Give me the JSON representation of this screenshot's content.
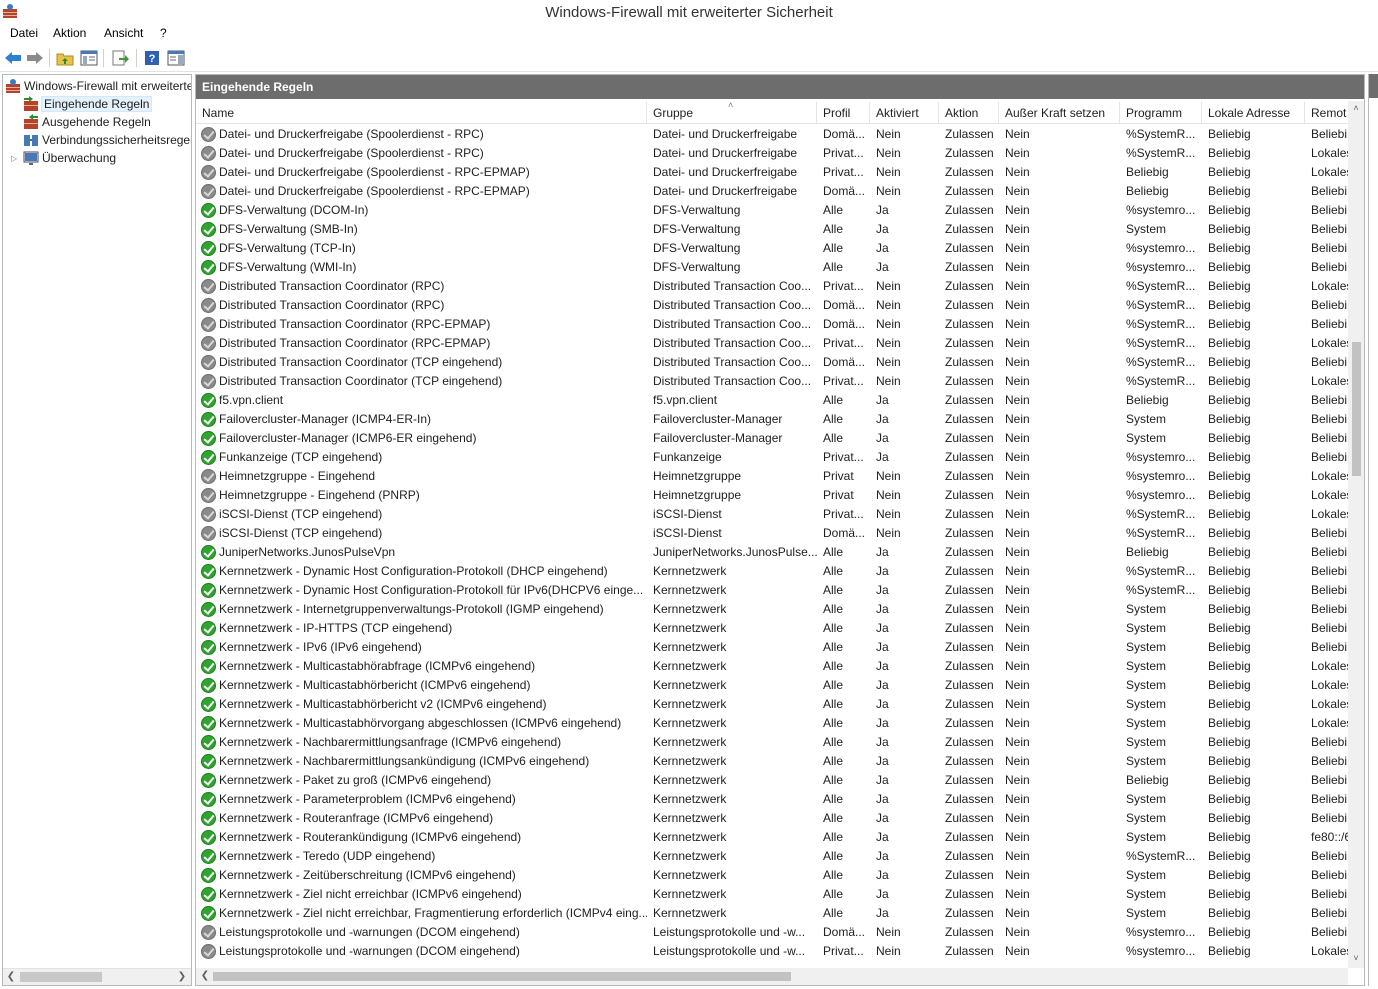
{
  "window": {
    "title": "Windows-Firewall mit erweiterter Sicherheit"
  },
  "menu": [
    "Datei",
    "Aktion",
    "Ansicht",
    "?"
  ],
  "toolbar": {
    "buttons": [
      "back-icon",
      "forward-icon",
      "up-folder-icon",
      "show-hide-tree-icon",
      "export-icon",
      "help-icon",
      "show-hide-action-pane-icon"
    ]
  },
  "tree": {
    "root": "Windows-Firewall mit erweiterter Sicherheit",
    "items": [
      {
        "label": "Eingehende Regeln",
        "selected": true
      },
      {
        "label": "Ausgehende Regeln",
        "selected": false
      },
      {
        "label": "Verbindungssicherheitsregeln",
        "selected": false
      },
      {
        "label": "Überwachung",
        "selected": false
      }
    ]
  },
  "pane": {
    "title": "Eingehende Regeln"
  },
  "columns": [
    "Name",
    "Gruppe",
    "Profil",
    "Aktiviert",
    "Aktion",
    "Außer Kraft setzen",
    "Programm",
    "Lokale Adresse",
    "Remot"
  ],
  "colors": {
    "enabled": "#2fa52f",
    "disabled": "#8a8a8a",
    "header": "#6d6d6d"
  },
  "rows": [
    [
      "d",
      "Datei- und Druckerfreigabe (Spoolerdienst - RPC)",
      "Datei- und Druckerfreigabe",
      "Domä...",
      "Nein",
      "Zulassen",
      "Nein",
      "%SystemR...",
      "Beliebig",
      "Beliebi"
    ],
    [
      "d",
      "Datei- und Druckerfreigabe (Spoolerdienst - RPC)",
      "Datei- und Druckerfreigabe",
      "Privat...",
      "Nein",
      "Zulassen",
      "Nein",
      "%SystemR...",
      "Beliebig",
      "Lokales"
    ],
    [
      "d",
      "Datei- und Druckerfreigabe (Spoolerdienst - RPC-EPMAP)",
      "Datei- und Druckerfreigabe",
      "Privat...",
      "Nein",
      "Zulassen",
      "Nein",
      "Beliebig",
      "Beliebig",
      "Lokales"
    ],
    [
      "d",
      "Datei- und Druckerfreigabe (Spoolerdienst - RPC-EPMAP)",
      "Datei- und Druckerfreigabe",
      "Domä...",
      "Nein",
      "Zulassen",
      "Nein",
      "Beliebig",
      "Beliebig",
      "Beliebi"
    ],
    [
      "e",
      "DFS-Verwaltung (DCOM-In)",
      "DFS-Verwaltung",
      "Alle",
      "Ja",
      "Zulassen",
      "Nein",
      "%systemro...",
      "Beliebig",
      "Beliebi"
    ],
    [
      "e",
      "DFS-Verwaltung (SMB-In)",
      "DFS-Verwaltung",
      "Alle",
      "Ja",
      "Zulassen",
      "Nein",
      "System",
      "Beliebig",
      "Beliebi"
    ],
    [
      "e",
      "DFS-Verwaltung (TCP-In)",
      "DFS-Verwaltung",
      "Alle",
      "Ja",
      "Zulassen",
      "Nein",
      "%systemro...",
      "Beliebig",
      "Beliebi"
    ],
    [
      "e",
      "DFS-Verwaltung (WMI-In)",
      "DFS-Verwaltung",
      "Alle",
      "Ja",
      "Zulassen",
      "Nein",
      "%systemro...",
      "Beliebig",
      "Beliebi"
    ],
    [
      "d",
      "Distributed Transaction Coordinator (RPC)",
      "Distributed Transaction Coo...",
      "Privat...",
      "Nein",
      "Zulassen",
      "Nein",
      "%SystemR...",
      "Beliebig",
      "Lokales"
    ],
    [
      "d",
      "Distributed Transaction Coordinator (RPC)",
      "Distributed Transaction Coo...",
      "Domä...",
      "Nein",
      "Zulassen",
      "Nein",
      "%SystemR...",
      "Beliebig",
      "Beliebi"
    ],
    [
      "d",
      "Distributed Transaction Coordinator (RPC-EPMAP)",
      "Distributed Transaction Coo...",
      "Domä...",
      "Nein",
      "Zulassen",
      "Nein",
      "%SystemR...",
      "Beliebig",
      "Beliebi"
    ],
    [
      "d",
      "Distributed Transaction Coordinator (RPC-EPMAP)",
      "Distributed Transaction Coo...",
      "Privat...",
      "Nein",
      "Zulassen",
      "Nein",
      "%SystemR...",
      "Beliebig",
      "Lokales"
    ],
    [
      "d",
      "Distributed Transaction Coordinator (TCP eingehend)",
      "Distributed Transaction Coo...",
      "Domä...",
      "Nein",
      "Zulassen",
      "Nein",
      "%SystemR...",
      "Beliebig",
      "Beliebi"
    ],
    [
      "d",
      "Distributed Transaction Coordinator (TCP eingehend)",
      "Distributed Transaction Coo...",
      "Privat...",
      "Nein",
      "Zulassen",
      "Nein",
      "%SystemR...",
      "Beliebig",
      "Lokales"
    ],
    [
      "e",
      "f5.vpn.client",
      "f5.vpn.client",
      "Alle",
      "Ja",
      "Zulassen",
      "Nein",
      "Beliebig",
      "Beliebig",
      "Beliebi"
    ],
    [
      "e",
      "Failovercluster-Manager (ICMP4-ER-In)",
      "Failovercluster-Manager",
      "Alle",
      "Ja",
      "Zulassen",
      "Nein",
      "System",
      "Beliebig",
      "Beliebi"
    ],
    [
      "e",
      "Failovercluster-Manager (ICMP6-ER eingehend)",
      "Failovercluster-Manager",
      "Alle",
      "Ja",
      "Zulassen",
      "Nein",
      "System",
      "Beliebig",
      "Beliebi"
    ],
    [
      "e",
      "Funkanzeige (TCP eingehend)",
      "Funkanzeige",
      "Privat...",
      "Ja",
      "Zulassen",
      "Nein",
      "%systemro...",
      "Beliebig",
      "Beliebi"
    ],
    [
      "d",
      "Heimnetzgruppe - Eingehend",
      "Heimnetzgruppe",
      "Privat",
      "Nein",
      "Zulassen",
      "Nein",
      "%systemro...",
      "Beliebig",
      "Lokales"
    ],
    [
      "d",
      "Heimnetzgruppe - Eingehend (PNRP)",
      "Heimnetzgruppe",
      "Privat",
      "Nein",
      "Zulassen",
      "Nein",
      "%systemro...",
      "Beliebig",
      "Lokales"
    ],
    [
      "d",
      "iSCSI-Dienst (TCP eingehend)",
      "iSCSI-Dienst",
      "Privat...",
      "Nein",
      "Zulassen",
      "Nein",
      "%SystemR...",
      "Beliebig",
      "Lokales"
    ],
    [
      "d",
      "iSCSI-Dienst (TCP eingehend)",
      "iSCSI-Dienst",
      "Domä...",
      "Nein",
      "Zulassen",
      "Nein",
      "%SystemR...",
      "Beliebig",
      "Beliebi"
    ],
    [
      "e",
      "JuniperNetworks.JunosPulseVpn",
      "JuniperNetworks.JunosPulse...",
      "Alle",
      "Ja",
      "Zulassen",
      "Nein",
      "Beliebig",
      "Beliebig",
      "Beliebi"
    ],
    [
      "e",
      "Kernnetzwerk - Dynamic Host Configuration-Protokoll (DHCP eingehend)",
      "Kernnetzwerk",
      "Alle",
      "Ja",
      "Zulassen",
      "Nein",
      "%SystemR...",
      "Beliebig",
      "Beliebi"
    ],
    [
      "e",
      "Kernnetzwerk - Dynamic Host Configuration-Protokoll für IPv6(DHCPV6 einge...",
      "Kernnetzwerk",
      "Alle",
      "Ja",
      "Zulassen",
      "Nein",
      "%SystemR...",
      "Beliebig",
      "Beliebi"
    ],
    [
      "e",
      "Kernnetzwerk - Internetgruppenverwaltungs-Protokoll (IGMP eingehend)",
      "Kernnetzwerk",
      "Alle",
      "Ja",
      "Zulassen",
      "Nein",
      "System",
      "Beliebig",
      "Beliebi"
    ],
    [
      "e",
      "Kernnetzwerk - IP-HTTPS (TCP eingehend)",
      "Kernnetzwerk",
      "Alle",
      "Ja",
      "Zulassen",
      "Nein",
      "System",
      "Beliebig",
      "Beliebi"
    ],
    [
      "e",
      "Kernnetzwerk - IPv6 (IPv6 eingehend)",
      "Kernnetzwerk",
      "Alle",
      "Ja",
      "Zulassen",
      "Nein",
      "System",
      "Beliebig",
      "Beliebi"
    ],
    [
      "e",
      "Kernnetzwerk - Multicastabhörabfrage (ICMPv6 eingehend)",
      "Kernnetzwerk",
      "Alle",
      "Ja",
      "Zulassen",
      "Nein",
      "System",
      "Beliebig",
      "Lokales"
    ],
    [
      "e",
      "Kernnetzwerk - Multicastabhörbericht (ICMPv6 eingehend)",
      "Kernnetzwerk",
      "Alle",
      "Ja",
      "Zulassen",
      "Nein",
      "System",
      "Beliebig",
      "Lokales"
    ],
    [
      "e",
      "Kernnetzwerk - Multicastabhörbericht v2 (ICMPv6 eingehend)",
      "Kernnetzwerk",
      "Alle",
      "Ja",
      "Zulassen",
      "Nein",
      "System",
      "Beliebig",
      "Lokales"
    ],
    [
      "e",
      "Kernnetzwerk - Multicastabhörvorgang abgeschlossen (ICMPv6 eingehend)",
      "Kernnetzwerk",
      "Alle",
      "Ja",
      "Zulassen",
      "Nein",
      "System",
      "Beliebig",
      "Lokales"
    ],
    [
      "e",
      "Kernnetzwerk - Nachbarermittlungsanfrage (ICMPv6 eingehend)",
      "Kernnetzwerk",
      "Alle",
      "Ja",
      "Zulassen",
      "Nein",
      "System",
      "Beliebig",
      "Beliebi"
    ],
    [
      "e",
      "Kernnetzwerk - Nachbarermittlungsankündigung (ICMPv6 eingehend)",
      "Kernnetzwerk",
      "Alle",
      "Ja",
      "Zulassen",
      "Nein",
      "System",
      "Beliebig",
      "Beliebi"
    ],
    [
      "e",
      "Kernnetzwerk - Paket zu groß (ICMPv6 eingehend)",
      "Kernnetzwerk",
      "Alle",
      "Ja",
      "Zulassen",
      "Nein",
      "Beliebig",
      "Beliebig",
      "Beliebi"
    ],
    [
      "e",
      "Kernnetzwerk - Parameterproblem (ICMPv6 eingehend)",
      "Kernnetzwerk",
      "Alle",
      "Ja",
      "Zulassen",
      "Nein",
      "System",
      "Beliebig",
      "Beliebi"
    ],
    [
      "e",
      "Kernnetzwerk - Routeranfrage (ICMPv6 eingehend)",
      "Kernnetzwerk",
      "Alle",
      "Ja",
      "Zulassen",
      "Nein",
      "System",
      "Beliebig",
      "Beliebi"
    ],
    [
      "e",
      "Kernnetzwerk - Routerankündigung (ICMPv6 eingehend)",
      "Kernnetzwerk",
      "Alle",
      "Ja",
      "Zulassen",
      "Nein",
      "System",
      "Beliebig",
      "fe80::/6"
    ],
    [
      "e",
      "Kernnetzwerk - Teredo (UDP eingehend)",
      "Kernnetzwerk",
      "Alle",
      "Ja",
      "Zulassen",
      "Nein",
      "%SystemR...",
      "Beliebig",
      "Beliebi"
    ],
    [
      "e",
      "Kernnetzwerk - Zeitüberschreitung (ICMPv6 eingehend)",
      "Kernnetzwerk",
      "Alle",
      "Ja",
      "Zulassen",
      "Nein",
      "System",
      "Beliebig",
      "Beliebi"
    ],
    [
      "e",
      "Kernnetzwerk - Ziel nicht erreichbar (ICMPv6 eingehend)",
      "Kernnetzwerk",
      "Alle",
      "Ja",
      "Zulassen",
      "Nein",
      "System",
      "Beliebig",
      "Beliebi"
    ],
    [
      "e",
      "Kernnetzwerk - Ziel nicht erreichbar, Fragmentierung erforderlich (ICMPv4 eing...",
      "Kernnetzwerk",
      "Alle",
      "Ja",
      "Zulassen",
      "Nein",
      "System",
      "Beliebig",
      "Beliebi"
    ],
    [
      "d",
      "Leistungsprotokolle und -warnungen (DCOM eingehend)",
      "Leistungsprotokolle und -w...",
      "Domä...",
      "Nein",
      "Zulassen",
      "Nein",
      "%systemro...",
      "Beliebig",
      "Beliebi"
    ],
    [
      "d",
      "Leistungsprotokolle und -warnungen (DCOM eingehend)",
      "Leistungsprotokolle und -w...",
      "Privat...",
      "Nein",
      "Zulassen",
      "Nein",
      "%systemro...",
      "Beliebig",
      "Lokales"
    ]
  ]
}
